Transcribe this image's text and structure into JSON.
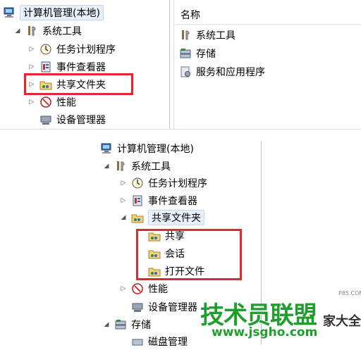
{
  "top": {
    "root_label": "计算机管理(本地)",
    "items": [
      {
        "label": "系统工具",
        "icon": "tools-icon"
      },
      {
        "label": "任务计划程序",
        "icon": "clock-icon"
      },
      {
        "label": "事件查看器",
        "icon": "event-viewer-icon"
      },
      {
        "label": "共享文件夹",
        "icon": "shared-folder-icon"
      },
      {
        "label": "性能",
        "icon": "performance-icon"
      },
      {
        "label": "设备管理器",
        "icon": "device-manager-icon"
      }
    ],
    "right_header": "名称",
    "right_items": [
      {
        "label": "系统工具",
        "icon": "tools-icon"
      },
      {
        "label": "存储",
        "icon": "storage-icon"
      },
      {
        "label": "服务和应用程序",
        "icon": "services-icon"
      }
    ]
  },
  "bottom": {
    "root_label": "计算机管理(本地)",
    "items": [
      {
        "label": "系统工具"
      },
      {
        "label": "任务计划程序"
      },
      {
        "label": "事件查看器"
      },
      {
        "label": "共享文件夹"
      },
      {
        "label": "共享"
      },
      {
        "label": "会话"
      },
      {
        "label": "打开文件"
      },
      {
        "label": "性能"
      },
      {
        "label": "设备管理器"
      },
      {
        "label": "存储"
      },
      {
        "label": "磁盘管理"
      }
    ]
  },
  "watermark": {
    "main": "技术员联盟",
    "url": "www.jsgho.com",
    "side": "家大全",
    "small": "P85.COM"
  },
  "colors": {
    "highlight_red": "#e0262f",
    "watermark_green": "#1e9e2a",
    "selection_bg": "#e8f0fb"
  }
}
